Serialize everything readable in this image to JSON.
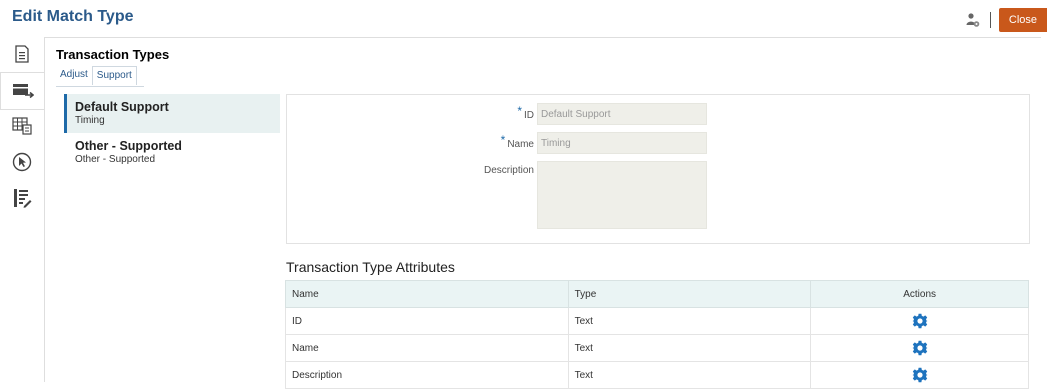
{
  "header": {
    "title": "Edit Match Type",
    "close_label": "Close",
    "colors": {
      "title": "#2b5a8a",
      "close_bg": "#c9581b",
      "accent": "#1e6aa8"
    }
  },
  "rail": {
    "items": [
      {
        "icon": "document-list-icon"
      },
      {
        "icon": "transfer-card-icon",
        "active": true
      },
      {
        "icon": "table-grid-icon"
      },
      {
        "icon": "cursor-circle-icon"
      },
      {
        "icon": "list-edit-icon"
      }
    ]
  },
  "section": {
    "title": "Transaction Types",
    "tabs": [
      {
        "label": "Adjust",
        "selected": false
      },
      {
        "label": "Support",
        "selected": true
      }
    ]
  },
  "list": {
    "items": [
      {
        "title": "Default Support",
        "subtitle": "Timing",
        "selected": true
      },
      {
        "title": "Other - Supported",
        "subtitle": "Other - Supported",
        "selected": false
      }
    ]
  },
  "form": {
    "id": {
      "label": "ID",
      "required": "*",
      "value": "Default Support"
    },
    "name": {
      "label": "Name",
      "required": "*",
      "value": "Timing"
    },
    "description": {
      "label": "Description",
      "value": ""
    }
  },
  "attributes": {
    "title": "Transaction Type Attributes",
    "columns": [
      "Name",
      "Type",
      "Actions"
    ],
    "rows": [
      {
        "name": "ID",
        "type": "Text",
        "action_icon": "gear-icon"
      },
      {
        "name": "Name",
        "type": "Text",
        "action_icon": "gear-icon"
      },
      {
        "name": "Description",
        "type": "Text",
        "action_icon": "gear-icon"
      }
    ]
  }
}
